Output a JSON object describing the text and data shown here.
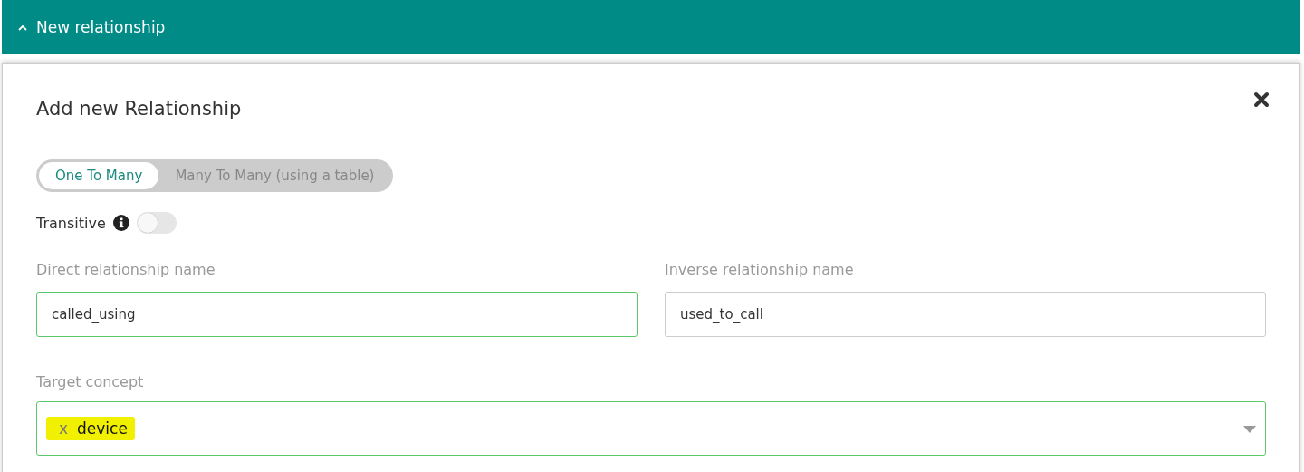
{
  "panel": {
    "title": "New relationship",
    "expanded": true
  },
  "dialog": {
    "title": "Add new Relationship",
    "mode_options": [
      {
        "label": "One To Many",
        "selected": true
      },
      {
        "label": "Many To Many (using a table)",
        "selected": false
      }
    ],
    "transitive": {
      "label": "Transitive",
      "on": false
    },
    "fields": [
      {
        "label": "Direct relationship name",
        "value": "called_using",
        "valid": true
      },
      {
        "label": "Inverse relationship name",
        "value": "used_to_call",
        "valid": false
      }
    ],
    "target": {
      "label": "Target concept",
      "valid": true,
      "tags": [
        {
          "remove": "x",
          "label": "device"
        }
      ]
    }
  }
}
